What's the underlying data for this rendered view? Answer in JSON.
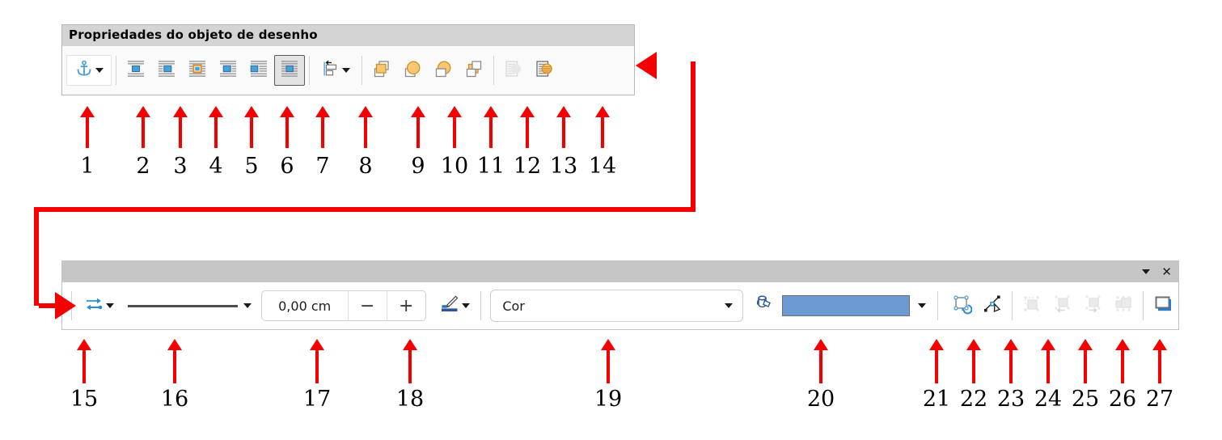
{
  "toolbar1": {
    "title": "Propriedades do objeto de desenho",
    "buttons": [
      {
        "n": 1,
        "name": "anchor",
        "icon": "anchor-icon",
        "dropdown": true,
        "state": "framed"
      },
      {
        "n": 2,
        "name": "wrap-off",
        "icon": "wrap-off-icon",
        "dropdown": false,
        "state": "normal"
      },
      {
        "n": 3,
        "name": "wrap-left",
        "icon": "wrap-left-icon",
        "dropdown": false,
        "state": "normal"
      },
      {
        "n": 4,
        "name": "wrap-parallel",
        "icon": "wrap-parallel-icon",
        "dropdown": false,
        "state": "normal"
      },
      {
        "n": 5,
        "name": "wrap-right",
        "icon": "wrap-right-icon",
        "dropdown": false,
        "state": "normal"
      },
      {
        "n": 6,
        "name": "wrap-optimal",
        "icon": "wrap-optimal-icon",
        "dropdown": false,
        "state": "normal"
      },
      {
        "n": 7,
        "name": "wrap-through",
        "icon": "wrap-through-icon",
        "dropdown": false,
        "state": "active"
      },
      {
        "n": 8,
        "name": "align-objects",
        "icon": "align-left-icon",
        "dropdown": true,
        "state": "normal"
      },
      {
        "n": 9,
        "name": "bring-forward",
        "icon": "bring-forward-icon",
        "dropdown": false,
        "state": "normal"
      },
      {
        "n": 10,
        "name": "bring-to-front",
        "icon": "bring-to-front-icon",
        "dropdown": false,
        "state": "normal"
      },
      {
        "n": 11,
        "name": "send-to-back",
        "icon": "send-to-back-icon",
        "dropdown": false,
        "state": "normal"
      },
      {
        "n": 12,
        "name": "send-backward",
        "icon": "send-backward-icon",
        "dropdown": false,
        "state": "normal"
      },
      {
        "n": 13,
        "name": "to-background",
        "icon": "to-background-icon",
        "dropdown": false,
        "state": "disabled"
      },
      {
        "n": 14,
        "name": "to-foreground",
        "icon": "to-foreground-icon",
        "dropdown": false,
        "state": "normal"
      }
    ]
  },
  "toolbar2": {
    "titlebar": {
      "dropdown_icon": "chevron-down-icon",
      "close_icon": "close-icon"
    },
    "arrow_style": {
      "label": "arrow-style",
      "icon": "arrow-style-icon",
      "dropdown": true
    },
    "line_style": {
      "label": "line-style",
      "icon": "line-preview",
      "dropdown": true
    },
    "line_width": {
      "value": "0,00 cm",
      "decrease_label": "−",
      "increase_label": "+"
    },
    "line_color": {
      "label": "line-color",
      "icon": "line-color-icon",
      "dropdown": true,
      "color": "#2b5797"
    },
    "fill_style": {
      "value": "Cor",
      "dropdown_icon": "chevron-down-icon"
    },
    "fill_color": {
      "label": "fill-color",
      "icon": "paint-can-icon",
      "color": "#6b9bd2",
      "dropdown_icon": "chevron-down-icon"
    },
    "buttons": [
      {
        "n": 21,
        "name": "rotate",
        "icon": "rotate-icon",
        "state": "normal"
      },
      {
        "n": 22,
        "name": "points",
        "icon": "points-icon",
        "state": "normal"
      },
      {
        "n": 23,
        "name": "align-objects-group",
        "icon": "align-objects-icon",
        "state": "disabled"
      },
      {
        "n": 24,
        "name": "enter-group",
        "icon": "enter-group-icon",
        "state": "disabled"
      },
      {
        "n": 25,
        "name": "exit-group",
        "icon": "exit-group-icon",
        "state": "disabled"
      },
      {
        "n": 26,
        "name": "ungroup",
        "icon": "ungroup-icon",
        "state": "disabled"
      },
      {
        "n": 27,
        "name": "shadow",
        "icon": "shadow-icon",
        "state": "normal"
      }
    ]
  },
  "callouts": {
    "top_row": [
      "1",
      "2",
      "3",
      "4",
      "5",
      "6",
      "7",
      "8",
      "9",
      "10",
      "11",
      "12",
      "13",
      "14"
    ],
    "bottom_row": [
      "15",
      "16",
      "17",
      "18",
      "19",
      "20",
      "21",
      "22",
      "23",
      "24",
      "25",
      "26",
      "27"
    ]
  },
  "colors": {
    "annotation_red": "#f50000",
    "toolbar1_title_bg": "#d4d4d4",
    "toolbar2_title_bg": "#c6c6c6",
    "accent_blue": "#4a90d9",
    "accent_orange": "#f5b942",
    "fill_blue": "#6b9bd2"
  }
}
